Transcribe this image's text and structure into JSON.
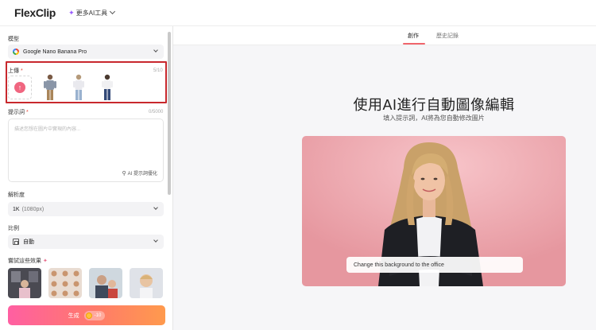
{
  "app": {
    "logo_text": "FlexClip",
    "more_tools": "更多AI工具"
  },
  "left": {
    "model_label": "模型",
    "model_value": "Google Nano Banana Pro",
    "upload_label": "上傳",
    "upload_required": "*",
    "upload_count": "5/10",
    "prompt_label": "提示詞",
    "prompt_required": "*",
    "prompt_count": "0/5000",
    "prompt_placeholder": "描述您想在圖片中實現的內容...",
    "ai_optimize": "AI 提示詞優化",
    "resolution_label": "解析度",
    "resolution_value": "1K",
    "resolution_sub": "(1080px)",
    "ratio_label": "比例",
    "ratio_value": "自動",
    "effects_label": "嘗試這些效果",
    "generate_label": "生成",
    "generate_cost": "-10"
  },
  "main": {
    "tabs": [
      {
        "label": "創作"
      },
      {
        "label": "歷史記錄"
      }
    ],
    "headline": "使用AI進行自動圖像編輯",
    "subline": "填入提示詞，AI將為您自動修改圖片",
    "sample_prompt": "Change this background to the office"
  }
}
